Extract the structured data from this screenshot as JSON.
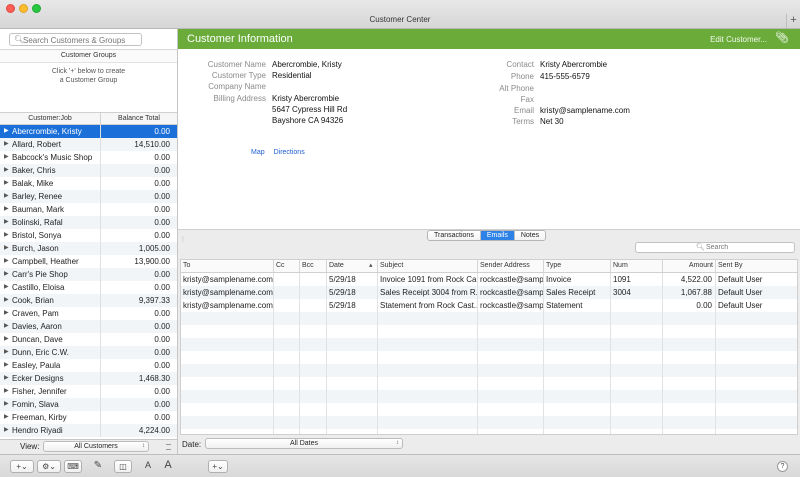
{
  "window": {
    "title": "Customer Center"
  },
  "sidebar": {
    "search_placeholder": "Search Customers & Groups",
    "groups_header": "Customer Groups",
    "groups_hint_line1": "Click '+' below to create",
    "groups_hint_line2": "a Customer Group",
    "col_job": "Customer:Job",
    "col_balance": "Balance Total",
    "customers": [
      {
        "name": "Abercrombie, Kristy",
        "balance": "0.00"
      },
      {
        "name": "Allard, Robert",
        "balance": "14,510.00"
      },
      {
        "name": "Babcock's Music Shop",
        "balance": "0.00"
      },
      {
        "name": "Baker, Chris",
        "balance": "0.00"
      },
      {
        "name": "Balak, Mike",
        "balance": "0.00"
      },
      {
        "name": "Barley, Renee",
        "balance": "0.00"
      },
      {
        "name": "Bauman, Mark",
        "balance": "0.00"
      },
      {
        "name": "Bolinski, Rafal",
        "balance": "0.00"
      },
      {
        "name": "Bristol, Sonya",
        "balance": "0.00"
      },
      {
        "name": "Burch, Jason",
        "balance": "1,005.00"
      },
      {
        "name": "Campbell, Heather",
        "balance": "13,900.00"
      },
      {
        "name": "Carr's Pie Shop",
        "balance": "0.00"
      },
      {
        "name": "Castillo, Eloisa",
        "balance": "0.00"
      },
      {
        "name": "Cook, Brian",
        "balance": "9,397.33"
      },
      {
        "name": "Craven, Pam",
        "balance": "0.00"
      },
      {
        "name": "Davies, Aaron",
        "balance": "0.00"
      },
      {
        "name": "Duncan, Dave",
        "balance": "0.00"
      },
      {
        "name": "Dunn, Eric C.W.",
        "balance": "0.00"
      },
      {
        "name": "Easley, Paula",
        "balance": "0.00"
      },
      {
        "name": "Ecker Designs",
        "balance": "1,468.30"
      },
      {
        "name": "Fisher, Jennifer",
        "balance": "0.00"
      },
      {
        "name": "Fomin, Slava",
        "balance": "0.00"
      },
      {
        "name": "Freeman, Kirby",
        "balance": "0.00"
      },
      {
        "name": "Hendro Riyadi",
        "balance": "4,224.00"
      }
    ],
    "view_label": "View:",
    "view_value": "All Customers"
  },
  "main": {
    "title": "Customer Information",
    "edit_label": "Edit Customer...",
    "fields_left": [
      {
        "label": "Customer Name",
        "value": "Abercrombie, Kristy"
      },
      {
        "label": "Customer Type",
        "value": "Residential"
      },
      {
        "label": "Company Name",
        "value": ""
      },
      {
        "label": "Billing Address",
        "value": "Kristy Abercrombie"
      }
    ],
    "address_line2": "5647 Cypress Hill Rd",
    "address_line3": "Bayshore CA 94326",
    "fields_right": [
      {
        "label": "Contact",
        "value": "Kristy Abercrombie"
      },
      {
        "label": "Phone",
        "value": "415-555-6579"
      },
      {
        "label": "Alt Phone",
        "value": ""
      },
      {
        "label": "Fax",
        "value": ""
      },
      {
        "label": "Email",
        "value": "kristy@samplename.com"
      },
      {
        "label": "Terms",
        "value": "Net 30"
      }
    ],
    "map_link": "Map",
    "directions_link": "Directions"
  },
  "tabs": [
    "Transactions",
    "Emails",
    "Notes"
  ],
  "emails": {
    "search_placeholder": "Search",
    "columns": [
      "To",
      "Cc",
      "Bcc",
      "Date",
      "Subject",
      "Sender Address",
      "Type",
      "Num",
      "Amount",
      "Sent By"
    ],
    "rows": [
      {
        "to": "kristy@samplename.com",
        "cc": "",
        "bcc": "",
        "date": "5/29/18",
        "subject": "Invoice 1091 from Rock Ca...",
        "sender": "rockcastle@samp",
        "type": "Invoice",
        "num": "1091",
        "amount": "4,522.00",
        "sent_by": "Default User"
      },
      {
        "to": "kristy@samplename.com",
        "cc": "",
        "bcc": "",
        "date": "5/29/18",
        "subject": "Sales Receipt 3004 from R...",
        "sender": "rockcastle@samp",
        "type": "Sales Receipt",
        "num": "3004",
        "amount": "1,067.88",
        "sent_by": "Default User"
      },
      {
        "to": "kristy@samplename.com",
        "cc": "",
        "bcc": "",
        "date": "5/29/18",
        "subject": "Statement from Rock Cast...",
        "sender": "rockcastle@samp",
        "type": "Statement",
        "num": "",
        "amount": "0.00",
        "sent_by": "Default User"
      }
    ],
    "date_label": "Date:",
    "date_value": "All Dates"
  }
}
